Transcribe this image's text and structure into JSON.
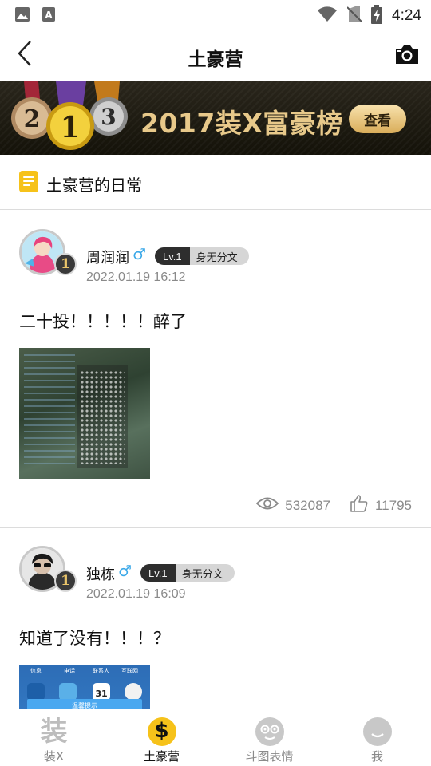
{
  "status_bar": {
    "time": "4:24"
  },
  "header": {
    "title": "土豪营"
  },
  "banner": {
    "title": "2017装X富豪榜",
    "button": "查看",
    "medals": [
      "2",
      "1",
      "3"
    ]
  },
  "section": {
    "title": "土豪营的日常"
  },
  "posts": [
    {
      "user": {
        "name": "周润润",
        "gender": "♂",
        "level": "Lv.1",
        "rank_title": "身无分文",
        "badge": "1"
      },
      "time": "2022.01.19 16:12",
      "text": "二十投！！！！！醉了",
      "views": "532087",
      "likes": "11795"
    },
    {
      "user": {
        "name": "独栋",
        "gender": "♂",
        "level": "Lv.1",
        "rank_title": "身无分文",
        "badge": "1"
      },
      "time": "2022.01.19 16:09",
      "text": "知道了没有！！！？",
      "image_labels": [
        "信息",
        "电话",
        "联系人",
        "互联网"
      ],
      "image_calendar": "31",
      "image_toast": "温馨提示"
    }
  ],
  "nav": [
    {
      "label": "装X",
      "icon": "zhuang-icon",
      "glyph": "装"
    },
    {
      "label": "土豪营",
      "icon": "dollar-icon",
      "glyph": "$"
    },
    {
      "label": "斗图表情",
      "icon": "emoji-face-icon"
    },
    {
      "label": "我",
      "icon": "profile-icon"
    }
  ],
  "colors": {
    "accent": "#f6c21a",
    "gender": "#3aa8e8",
    "gold": "#e8c98a",
    "muted": "#8a8a8a"
  }
}
